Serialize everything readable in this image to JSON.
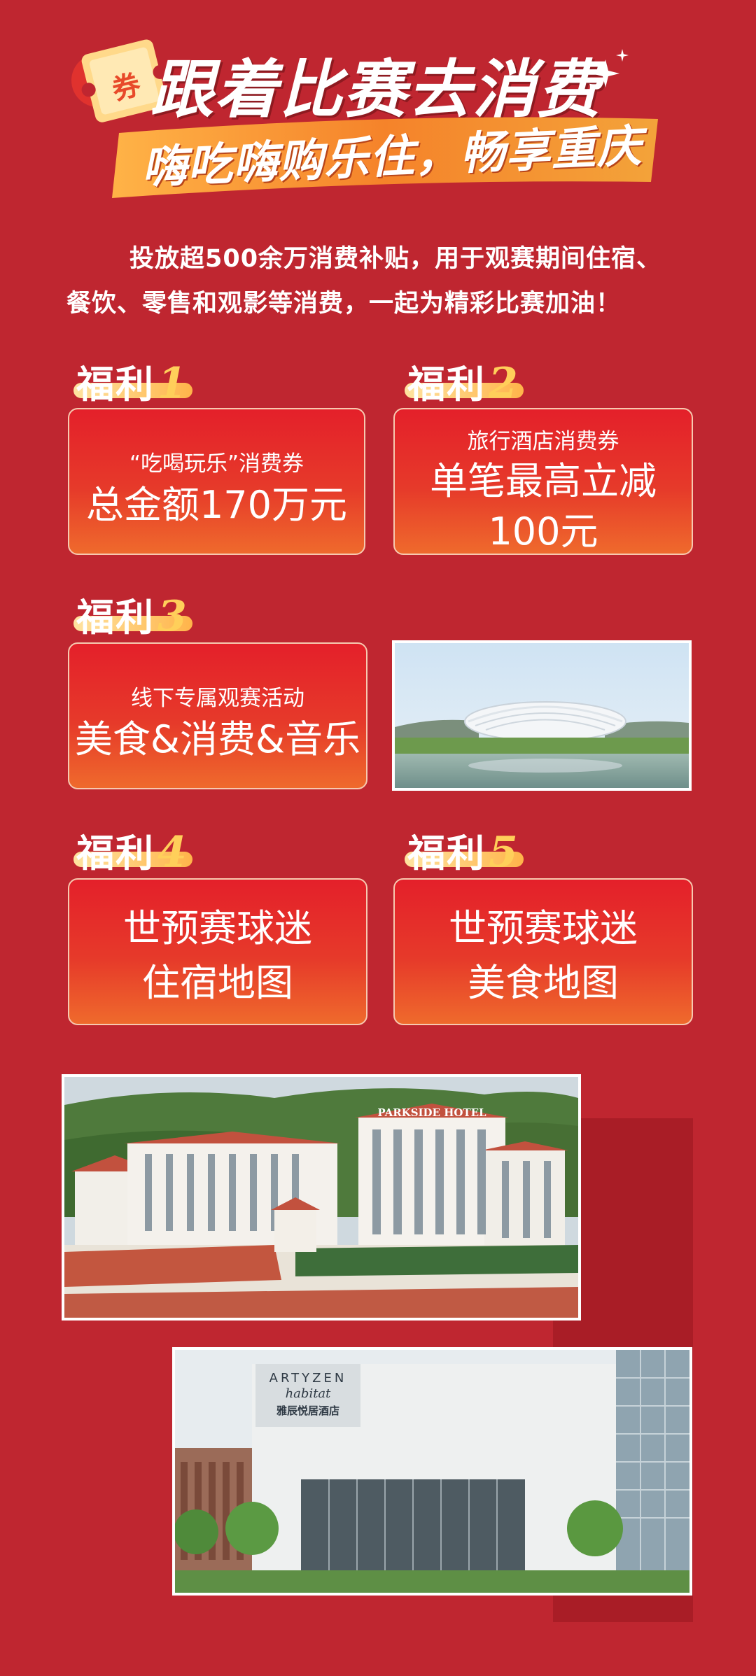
{
  "header": {
    "coupon_glyph": "券",
    "title": "跟着比赛去消费",
    "ribbon": "嗨吃嗨购乐住，畅享重庆"
  },
  "intro": [
    "投放超500余万消费补贴，用于观赛期间住宿、",
    "餐饮、零售和观影等消费，一起为精彩比赛加油！"
  ],
  "benefits": [
    {
      "label": "福利",
      "num": "1",
      "line1": "“吃喝玩乐”消费券",
      "line2": "总金额170万元"
    },
    {
      "label": "福利",
      "num": "2",
      "line1": "旅行酒店消费券",
      "line2": "单笔最高立减",
      "line3": "100元"
    },
    {
      "label": "福利",
      "num": "3",
      "line1": "线下专属观赛活动",
      "line2": "美食&消费&音乐"
    },
    {
      "label": "福利",
      "num": "4",
      "line1": "世预赛球迷",
      "line2": "住宿地图"
    },
    {
      "label": "福利",
      "num": "5",
      "line1": "世预赛球迷",
      "line2": "美食地图"
    }
  ],
  "photos": {
    "hotel1_sign": "PARKSIDE HOTEL",
    "hotel2_sign_line1": "ARTYZEN",
    "hotel2_sign_line2": "habitat",
    "hotel2_sign_line3": "雅辰悦居酒店"
  },
  "colors": {
    "background": "#bf2630",
    "card_top": "#e4202a",
    "card_bottom": "#ef6a2c",
    "accent_gold": "#ffcf5a",
    "ribbon_orange": "#f07a24"
  }
}
